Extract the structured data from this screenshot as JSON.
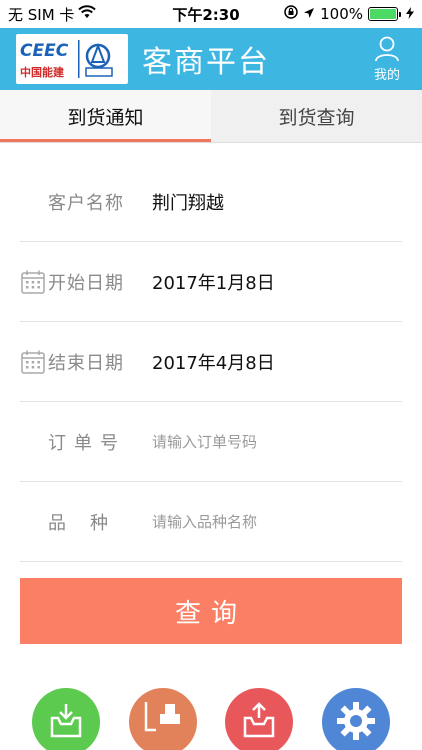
{
  "status_bar": {
    "carrier": "无 SIM 卡",
    "time": "下午2:30",
    "battery": "100%"
  },
  "header": {
    "brand": "中国能建",
    "title": "客商平台",
    "profile_label": "我的"
  },
  "tabs": [
    {
      "label": "到货通知",
      "active": true
    },
    {
      "label": "到货查询",
      "active": false
    }
  ],
  "form": {
    "customer": {
      "label": "客户名称",
      "value": "荆门翔越"
    },
    "start_date": {
      "label": "开始日期",
      "value": "2017年1月8日"
    },
    "end_date": {
      "label": "结束日期",
      "value": "2017年4月8日"
    },
    "order_no": {
      "label": "订单号",
      "placeholder": "请输入订单号码"
    },
    "variety": {
      "label": "品种",
      "placeholder": "请输入品种名称"
    }
  },
  "query_button": "查询",
  "colors": {
    "header_bg": "#3db6e2",
    "accent": "#f0765e",
    "button_bg": "#fb7f65"
  },
  "bottom_icons": [
    "inbox-in-icon",
    "forklift-icon",
    "outbox-icon",
    "settings-gear-icon"
  ]
}
